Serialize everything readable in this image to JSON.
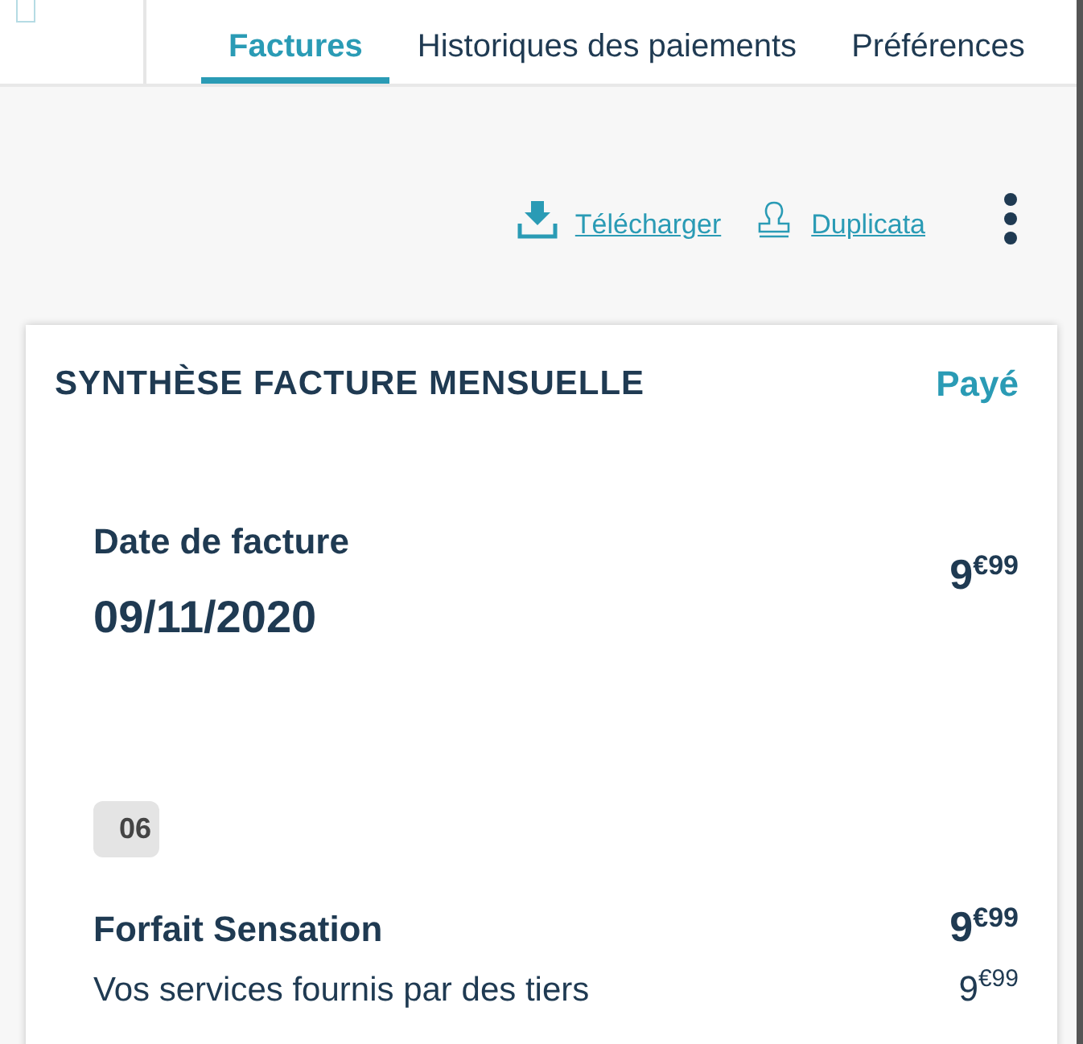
{
  "tabs": [
    {
      "label": "Factures",
      "selected": true
    },
    {
      "label": "Historiques des paiements",
      "selected": false
    },
    {
      "label": "Préférences",
      "selected": false
    }
  ],
  "actions": [
    {
      "kind": "download",
      "label": "Télécharger"
    },
    {
      "kind": "duplicate",
      "label": "Duplicata"
    }
  ],
  "card": {
    "title": "SYNTHÈSE FACTURE MENSUELLE",
    "status": "Payé",
    "date_label": "Date de facture",
    "date": "09/11/2020",
    "total": "9$^{€99}$",
    "month": "06",
    "lines": [
      {
        "kind": "main",
        "label": "Forfait Sensation",
        "amount": "9$^{€99}$"
      },
      {
        "kind": "sub",
        "label": "Vos services fournis par des tiers",
        "amount": "9$^{€99}$"
      }
    ]
  }
}
